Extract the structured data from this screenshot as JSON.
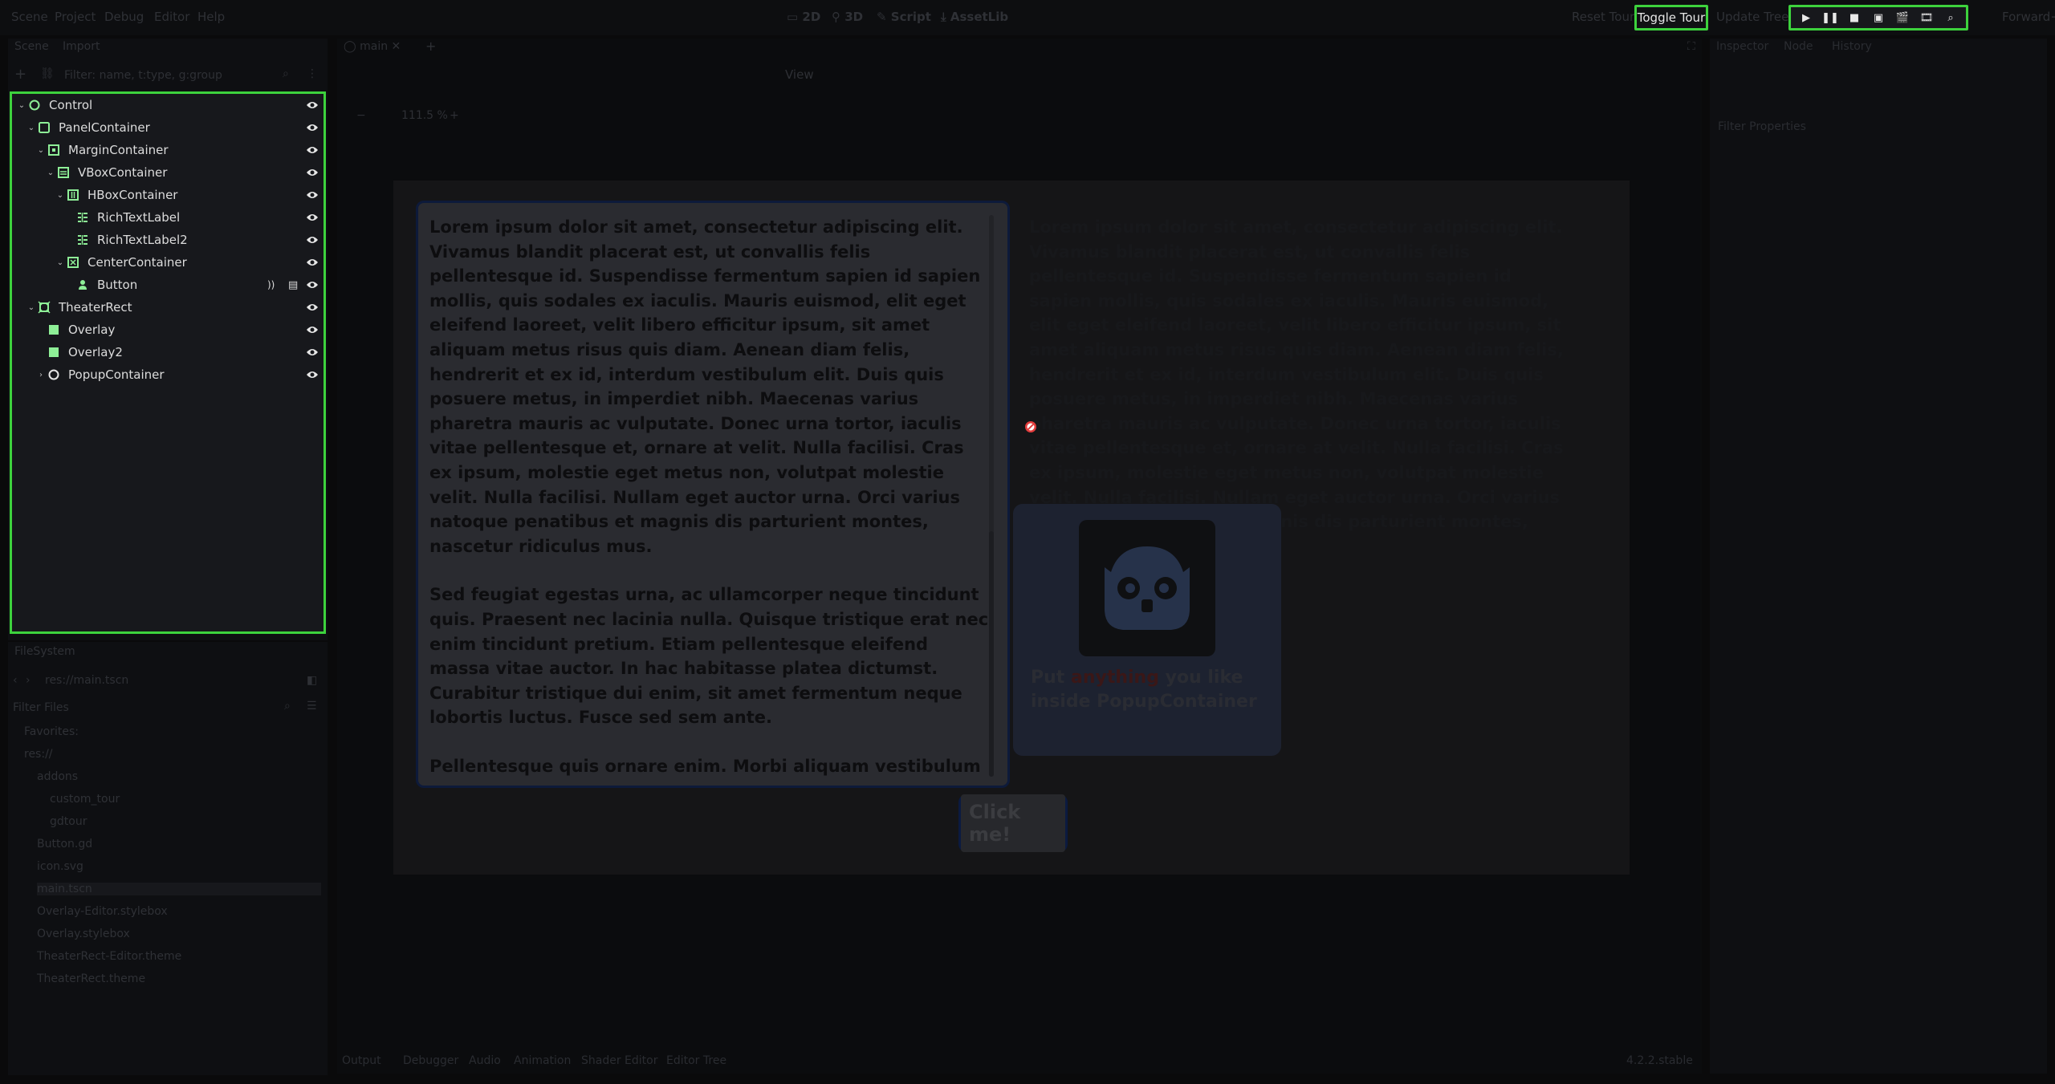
{
  "menubar": {
    "items": [
      "Scene",
      "Project",
      "Debug",
      "Editor",
      "Help"
    ],
    "workspaces": [
      "2D",
      "3D",
      "Script",
      "AssetLib"
    ],
    "reset_tour": "Reset Tour",
    "toggle_tour": "Toggle Tour",
    "update_tree": "Update Tree",
    "renderer": "Forward+"
  },
  "scene_dock": {
    "tabs": [
      "Scene",
      "Import"
    ],
    "filter_placeholder": "Filter: name, t:type, g:group",
    "nodes": [
      {
        "label": "Control",
        "depth": 0,
        "expanded": true,
        "icon": "control-circle-icon"
      },
      {
        "label": "PanelContainer",
        "depth": 1,
        "expanded": true,
        "icon": "panel-container-icon"
      },
      {
        "label": "MarginContainer",
        "depth": 2,
        "expanded": true,
        "icon": "margin-container-icon"
      },
      {
        "label": "VBoxContainer",
        "depth": 3,
        "expanded": true,
        "icon": "vbox-container-icon"
      },
      {
        "label": "HBoxContainer",
        "depth": 4,
        "expanded": true,
        "icon": "hbox-container-icon"
      },
      {
        "label": "RichTextLabel",
        "depth": 5,
        "icon": "rich-text-label-icon"
      },
      {
        "label": "RichTextLabel2",
        "depth": 5,
        "icon": "rich-text-label-icon"
      },
      {
        "label": "CenterContainer",
        "depth": 4,
        "expanded": true,
        "icon": "center-container-icon"
      },
      {
        "label": "Button",
        "depth": 5,
        "icon": "button-node-icon",
        "signals": true,
        "script": true
      },
      {
        "label": "TheaterRect",
        "depth": 1,
        "expanded": true,
        "icon": "theater-rect-icon"
      },
      {
        "label": "Overlay",
        "depth": 2,
        "icon": "color-rect-icon"
      },
      {
        "label": "Overlay2",
        "depth": 2,
        "icon": "color-rect-icon"
      },
      {
        "label": "PopupContainer",
        "depth": 2,
        "expanded": false,
        "icon": "popup-container-icon"
      }
    ]
  },
  "filesystem": {
    "title": "FileSystem",
    "path": "res://main.tscn",
    "filter_placeholder": "Filter Files",
    "items": [
      {
        "label": "Favorites:",
        "depth": 0
      },
      {
        "label": "res://",
        "depth": 0
      },
      {
        "label": "addons",
        "depth": 1
      },
      {
        "label": "custom_tour",
        "depth": 2
      },
      {
        "label": "gdtour",
        "depth": 2
      },
      {
        "label": "Button.gd",
        "depth": 1
      },
      {
        "label": "icon.svg",
        "depth": 1
      },
      {
        "label": "main.tscn",
        "depth": 1,
        "selected": true
      },
      {
        "label": "Overlay-Editor.stylebox",
        "depth": 1
      },
      {
        "label": "Overlay.stylebox",
        "depth": 1
      },
      {
        "label": "TheaterRect-Editor.theme",
        "depth": 1
      },
      {
        "label": "TheaterRect.theme",
        "depth": 1
      }
    ]
  },
  "viewport": {
    "tab": "main",
    "view_menu": "View",
    "zoom": "111.5 %",
    "richtext_1": "Lorem ipsum dolor sit amet, consectetur adipiscing elit. Vivamus blandit placerat est, ut convallis felis pellentesque id. Suspendisse fermentum sapien id sapien mollis, quis sodales ex iaculis. Mauris euismod, elit eget eleifend laoreet, velit libero efficitur ipsum, sit amet aliquam metus risus quis diam. Aenean diam felis, hendrerit et ex id, interdum vestibulum elit. Duis quis posuere metus, in imperdiet nibh. Maecenas varius pharetra mauris ac vulputate. Donec urna tortor, iaculis vitae pellentesque et, ornare at velit. Nulla facilisi. Cras ex ipsum, molestie eget metus non, volutpat molestie velit. Nulla facilisi. Nullam eget auctor urna. Orci varius natoque penatibus et magnis dis parturient montes, nascetur ridiculus mus.",
    "richtext_1b": "Sed feugiat egestas urna, ac ullamcorper neque tincidunt quis. Praesent nec lacinia nulla. Quisque tristique erat nec enim tincidunt pretium. Etiam pellentesque eleifend massa vitae auctor. In hac habitasse platea dictumst. Curabitur tristique dui enim, sit amet fermentum neque lobortis luctus. Fusce sed sem ante.",
    "richtext_1c": "Pellentesque quis ornare enim. Morbi aliquam vestibulum nisi, ac tempus metus porta non. Duis augue nunc, vehicula a auctor vel, euismod sed justo. In in orci dolor. Mauris quis fringilla elit, nec facilisis tortor. Phasellus ac turpis tempus, vestibulum arcu ac",
    "richtext_2": "Lorem ipsum dolor sit amet, consectetur adipiscing elit. Vivamus blandit placerat est, ut convallis felis pellentesque id. Suspendisse fermentum sapien id sapien mollis, quis sodales ex iaculis. Mauris euismod, elit eget eleifend laoreet, velit libero efficitur ipsum, sit amet aliquam metus risus quis diam. Aenean diam felis, hendrerit et ex id, interdum vestibulum elit. Duis quis posuere metus, in imperdiet nibh. Maecenas varius pharetra mauris ac vulputate. Donec urna tortor, iaculis vitae pellentesque et, ornare at velit. Nulla facilisi. Cras ex ipsum, molestie eget metus non, volutpat molestie velit. Nulla facilisi. Nullam eget auctor urna. Orci varius natoque penatibus et magnis dis parturient montes, nascetur ridiculus mus.",
    "popup_text_a": "Put ",
    "popup_text_b": "anything",
    "popup_text_c": " you like inside PopupContainer",
    "button_label": "Click me!"
  },
  "inspector": {
    "tabs": [
      "Inspector",
      "Node",
      "History"
    ],
    "filter_placeholder": "Filter Properties"
  },
  "bottom_panel": {
    "tabs": [
      "Output",
      "Debugger",
      "Audio",
      "Animation",
      "Shader Editor",
      "Editor Tree"
    ],
    "version": "4.2.2.stable"
  },
  "colors": {
    "highlight": "#3dd23d",
    "node_icon": "#8eef97",
    "control_icon": "#8eef97"
  }
}
